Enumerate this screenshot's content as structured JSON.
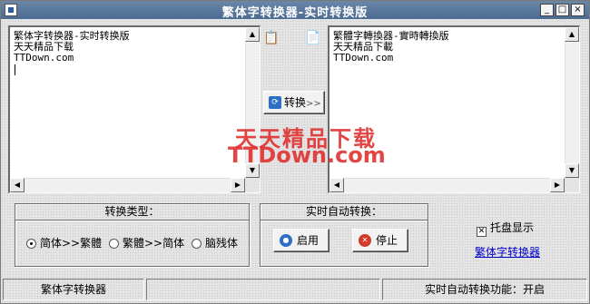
{
  "window": {
    "title": "繁体字转换器-实时转换版",
    "controls": [
      "_",
      "□",
      "×"
    ]
  },
  "left_pane": {
    "lines": [
      "繁体字转换器-实时转换版",
      "天天精品下载",
      "TTDown.com"
    ]
  },
  "right_pane": {
    "lines": [
      "繁體字轉換器-實時轉換版",
      "天天精品下載",
      "TTDown.com"
    ]
  },
  "center": {
    "paste_left_icon": "clipboard-icon",
    "paste_right_icon": "copy-icon",
    "convert_label": "转换",
    "convert_arrow": ">>",
    "watermark_line1": "天天精品下载",
    "watermark_line2": "TTDown.com"
  },
  "conversion_type": {
    "title": "转换类型：",
    "options": [
      "简体>>繁體",
      "繁體>>简体",
      "脑残体"
    ],
    "selected": "简体>>繁體"
  },
  "auto_convert": {
    "title": "实时自动转换：",
    "start_label": "启用",
    "stop_label": "停止"
  },
  "tray": {
    "label": "托盘显示",
    "checked": true
  },
  "link_text": "繁体字转换器",
  "status": {
    "app_name": "繁体字转换器",
    "auto_status": "实时自动转换功能：开启"
  },
  "colors": {
    "title_bar": "#4b6b92",
    "watermark": "#e03030",
    "link": "#0000cc"
  }
}
